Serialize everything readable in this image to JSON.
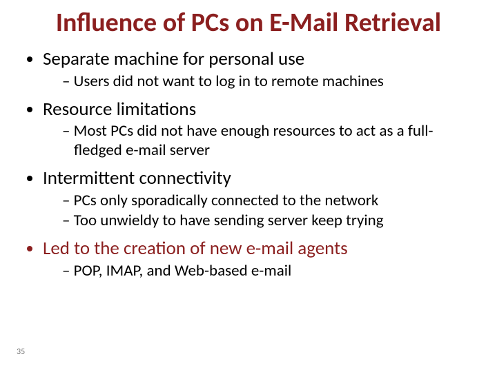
{
  "title": "Influence of PCs on E-Mail Retrieval",
  "bullets": [
    {
      "text": "Separate machine for personal use",
      "accent": false,
      "subs": [
        "Users did not want to log in to remote machines"
      ]
    },
    {
      "text": "Resource limitations",
      "accent": false,
      "subs": [
        "Most PCs did not have enough resources to act as a full-fledged e-mail server"
      ]
    },
    {
      "text": "Intermittent connectivity",
      "accent": false,
      "subs": [
        "PCs only sporadically connected to the network",
        "Too unwieldy to have sending server keep trying"
      ]
    },
    {
      "text": "Led to the creation of new e-mail agents",
      "accent": true,
      "subs": [
        "POP, IMAP, and Web-based e-mail"
      ]
    }
  ],
  "page_number": "35"
}
